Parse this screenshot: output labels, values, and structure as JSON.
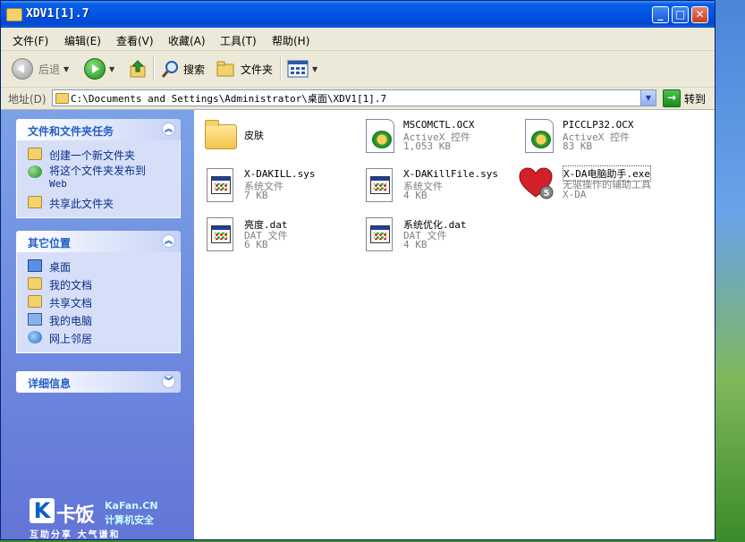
{
  "window": {
    "title": "XDV1[1].7",
    "buttons": {
      "minimize": "_",
      "maximize": "□",
      "close": "✕"
    }
  },
  "menu": [
    "文件(F)",
    "编辑(E)",
    "查看(V)",
    "收藏(A)",
    "工具(T)",
    "帮助(H)"
  ],
  "toolbar": {
    "back": "后退",
    "search": "搜索",
    "folders": "文件夹"
  },
  "address": {
    "label": "地址(D)",
    "path": "C:\\Documents and Settings\\Administrator\\桌面\\XDV1[1].7",
    "go": "转到"
  },
  "sidebar": {
    "tasks": {
      "title": "文件和文件夹任务",
      "items": [
        {
          "label": "创建一个新文件夹",
          "icon": "new-folder-icon"
        },
        {
          "label": "将这个文件夹发布到",
          "label2": "Web",
          "icon": "publish-web-icon"
        },
        {
          "label": "共享此文件夹",
          "icon": "share-folder-icon"
        }
      ]
    },
    "places": {
      "title": "其它位置",
      "items": [
        {
          "label": "桌面",
          "icon": "desktop-icon"
        },
        {
          "label": "我的文档",
          "icon": "my-documents-icon"
        },
        {
          "label": "共享文档",
          "icon": "shared-documents-icon"
        },
        {
          "label": "我的电脑",
          "icon": "my-computer-icon"
        },
        {
          "label": "网上邻居",
          "icon": "network-places-icon"
        }
      ]
    },
    "details": {
      "title": "详细信息"
    }
  },
  "logo": {
    "mark": "K",
    "name": "卡饭",
    "site": "KaFan.CN",
    "tagline": "计算机安全",
    "slogan": "互助分享  大气谦和"
  },
  "files": [
    {
      "name": "皮肤",
      "desc": "",
      "size": "",
      "icon": "folder-icon"
    },
    {
      "name": "MSCOMCTL.OCX",
      "desc": "ActiveX 控件",
      "size": "1,053 KB",
      "icon": "activex-icon"
    },
    {
      "name": "PICCLP32.OCX",
      "desc": "ActiveX 控件",
      "size": "83 KB",
      "icon": "activex-icon"
    },
    {
      "name": "X-DAKILL.sys",
      "desc": "系统文件",
      "size": "7 KB",
      "icon": "system-file-icon"
    },
    {
      "name": "X-DAKillFile.sys",
      "desc": "系统文件",
      "size": "4 KB",
      "icon": "system-file-icon"
    },
    {
      "name": "X-DA电脑助手.exe",
      "desc": "无驱操作的辅助工具",
      "size": "X-DA",
      "icon": "heart-app-icon"
    },
    {
      "name": "亮度.dat",
      "desc": "DAT 文件",
      "size": "6 KB",
      "icon": "dat-file-icon"
    },
    {
      "name": "系统优化.dat",
      "desc": "DAT 文件",
      "size": "4 KB",
      "icon": "dat-file-icon"
    }
  ]
}
